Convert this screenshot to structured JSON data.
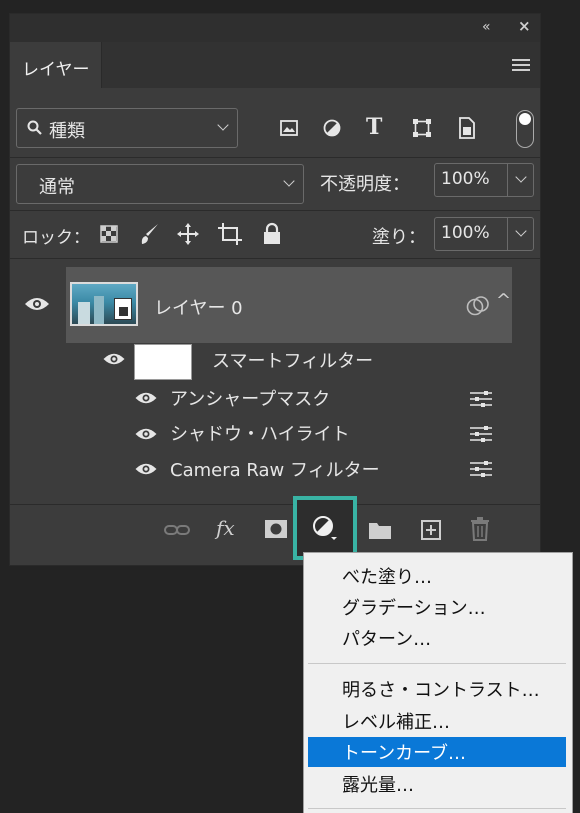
{
  "panel": {
    "topbar": {
      "collapse_icon": "double-chevron-left-icon",
      "close_icon": "close-icon"
    },
    "tab": {
      "label": "レイヤー"
    },
    "menu_icon": "hamburger-icon"
  },
  "filter": {
    "kind_value": "種類",
    "filter_icons": [
      "image-filter-icon",
      "adjustment-filter-icon",
      "type-filter-icon",
      "shape-filter-icon",
      "smart-object-filter-icon"
    ],
    "toggle_icon": "filter-toggle-icon"
  },
  "blend": {
    "mode_value": "通常",
    "opacity_label": "不透明度：",
    "opacity_value": "100%"
  },
  "lock": {
    "label": "ロック：",
    "icons": [
      "lock-transparency-icon",
      "lock-paint-icon",
      "lock-position-icon",
      "lock-artboard-icon",
      "lock-all-icon"
    ],
    "fill_label": "塗り：",
    "fill_value": "100%"
  },
  "layers": {
    "main": {
      "name": "レイヤー 0",
      "smart_icon": "smart-filter-icon"
    },
    "smart_filters": {
      "label": "スマートフィルター"
    },
    "filters": [
      {
        "name": "アンシャープマスク"
      },
      {
        "name": "シャドウ・ハイライト"
      },
      {
        "name": "Camera Raw フィルター"
      }
    ]
  },
  "footer": {
    "icons": [
      "link-icon",
      "fx-icon",
      "mask-icon",
      "adjustment-layer-icon",
      "group-folder-icon",
      "new-layer-icon",
      "trash-icon"
    ],
    "fx_label": "fx"
  },
  "menu": {
    "group1": [
      "べた塗り…",
      "グラデーション…",
      "パターン…"
    ],
    "group2": [
      "明るさ・コントラスト…",
      "レベル補正…",
      "トーンカーブ…",
      "露光量…"
    ],
    "selected": "トーンカーブ…",
    "selected_color": "#0a78d7",
    "highlight_color": "#39b3a4"
  }
}
